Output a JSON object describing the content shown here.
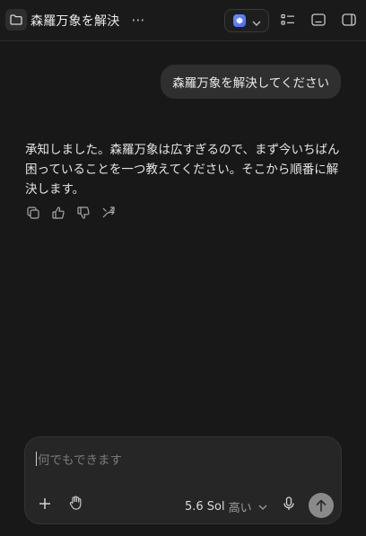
{
  "header": {
    "title": "森羅万象を解決",
    "more_label": "⋯",
    "model_logo_color": "#5a7cff"
  },
  "conversation": {
    "user_message": "森羅万象を解決してください",
    "assistant_message": "承知しました。森羅万象は広すぎるので、まず今いちばん困っていることを一つ教えてください。そこから順番に解決します。"
  },
  "composer": {
    "placeholder": "何でもできます",
    "model_name": "5.6 Sol",
    "effort_label": "高い"
  },
  "icons": {
    "folder": "folder-icon",
    "more": "more-icon",
    "model": "model-logo-icon",
    "chevron": "chevron-down-icon",
    "checklist": "checklist-icon",
    "terminal": "terminal-icon",
    "sidebar": "sidebar-toggle-icon",
    "copy": "copy-icon",
    "thumbs_up": "thumbs-up-icon",
    "thumbs_down": "thumbs-down-icon",
    "branch": "branch-icon",
    "plus": "plus-icon",
    "hand": "hand-icon",
    "mic": "mic-icon",
    "send": "arrow-up-icon"
  }
}
